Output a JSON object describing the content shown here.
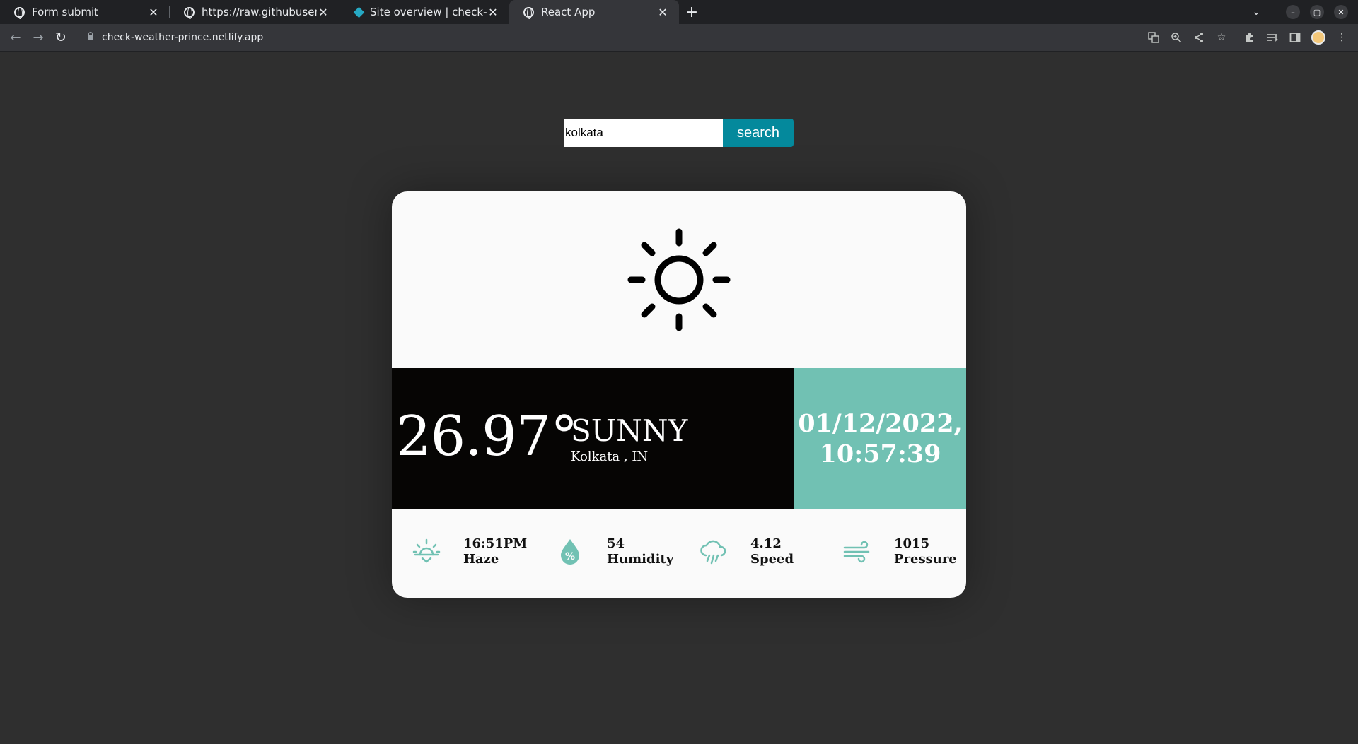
{
  "browser": {
    "tabs": [
      {
        "title": "Form submit",
        "icon": "globe-icon",
        "active": false
      },
      {
        "title": "https://raw.githubuserco",
        "icon": "globe-icon",
        "active": false
      },
      {
        "title": "Site overview | check-wea",
        "icon": "netlify-icon",
        "active": false
      },
      {
        "title": "React App",
        "icon": "globe-icon",
        "active": true
      }
    ],
    "url": "check-weather-prince.netlify.app"
  },
  "search": {
    "value": "kolkata",
    "button_label": "search"
  },
  "weather": {
    "icon": "sun-icon",
    "temperature": "26.97°",
    "condition": "SUNNY",
    "location": "Kolkata , IN",
    "date": "01/12/2022,",
    "time": "10:57:39",
    "accent_color": "#71c1b3",
    "stats": [
      {
        "icon": "sunset-icon",
        "value": "16:51PM",
        "label": "Haze"
      },
      {
        "icon": "humidity-icon",
        "value": "54",
        "label": "Humidity"
      },
      {
        "icon": "rain-cloud-icon",
        "value": "4.12",
        "label": "Speed"
      },
      {
        "icon": "wind-icon",
        "value": "1015",
        "label": "Pressure"
      }
    ]
  }
}
